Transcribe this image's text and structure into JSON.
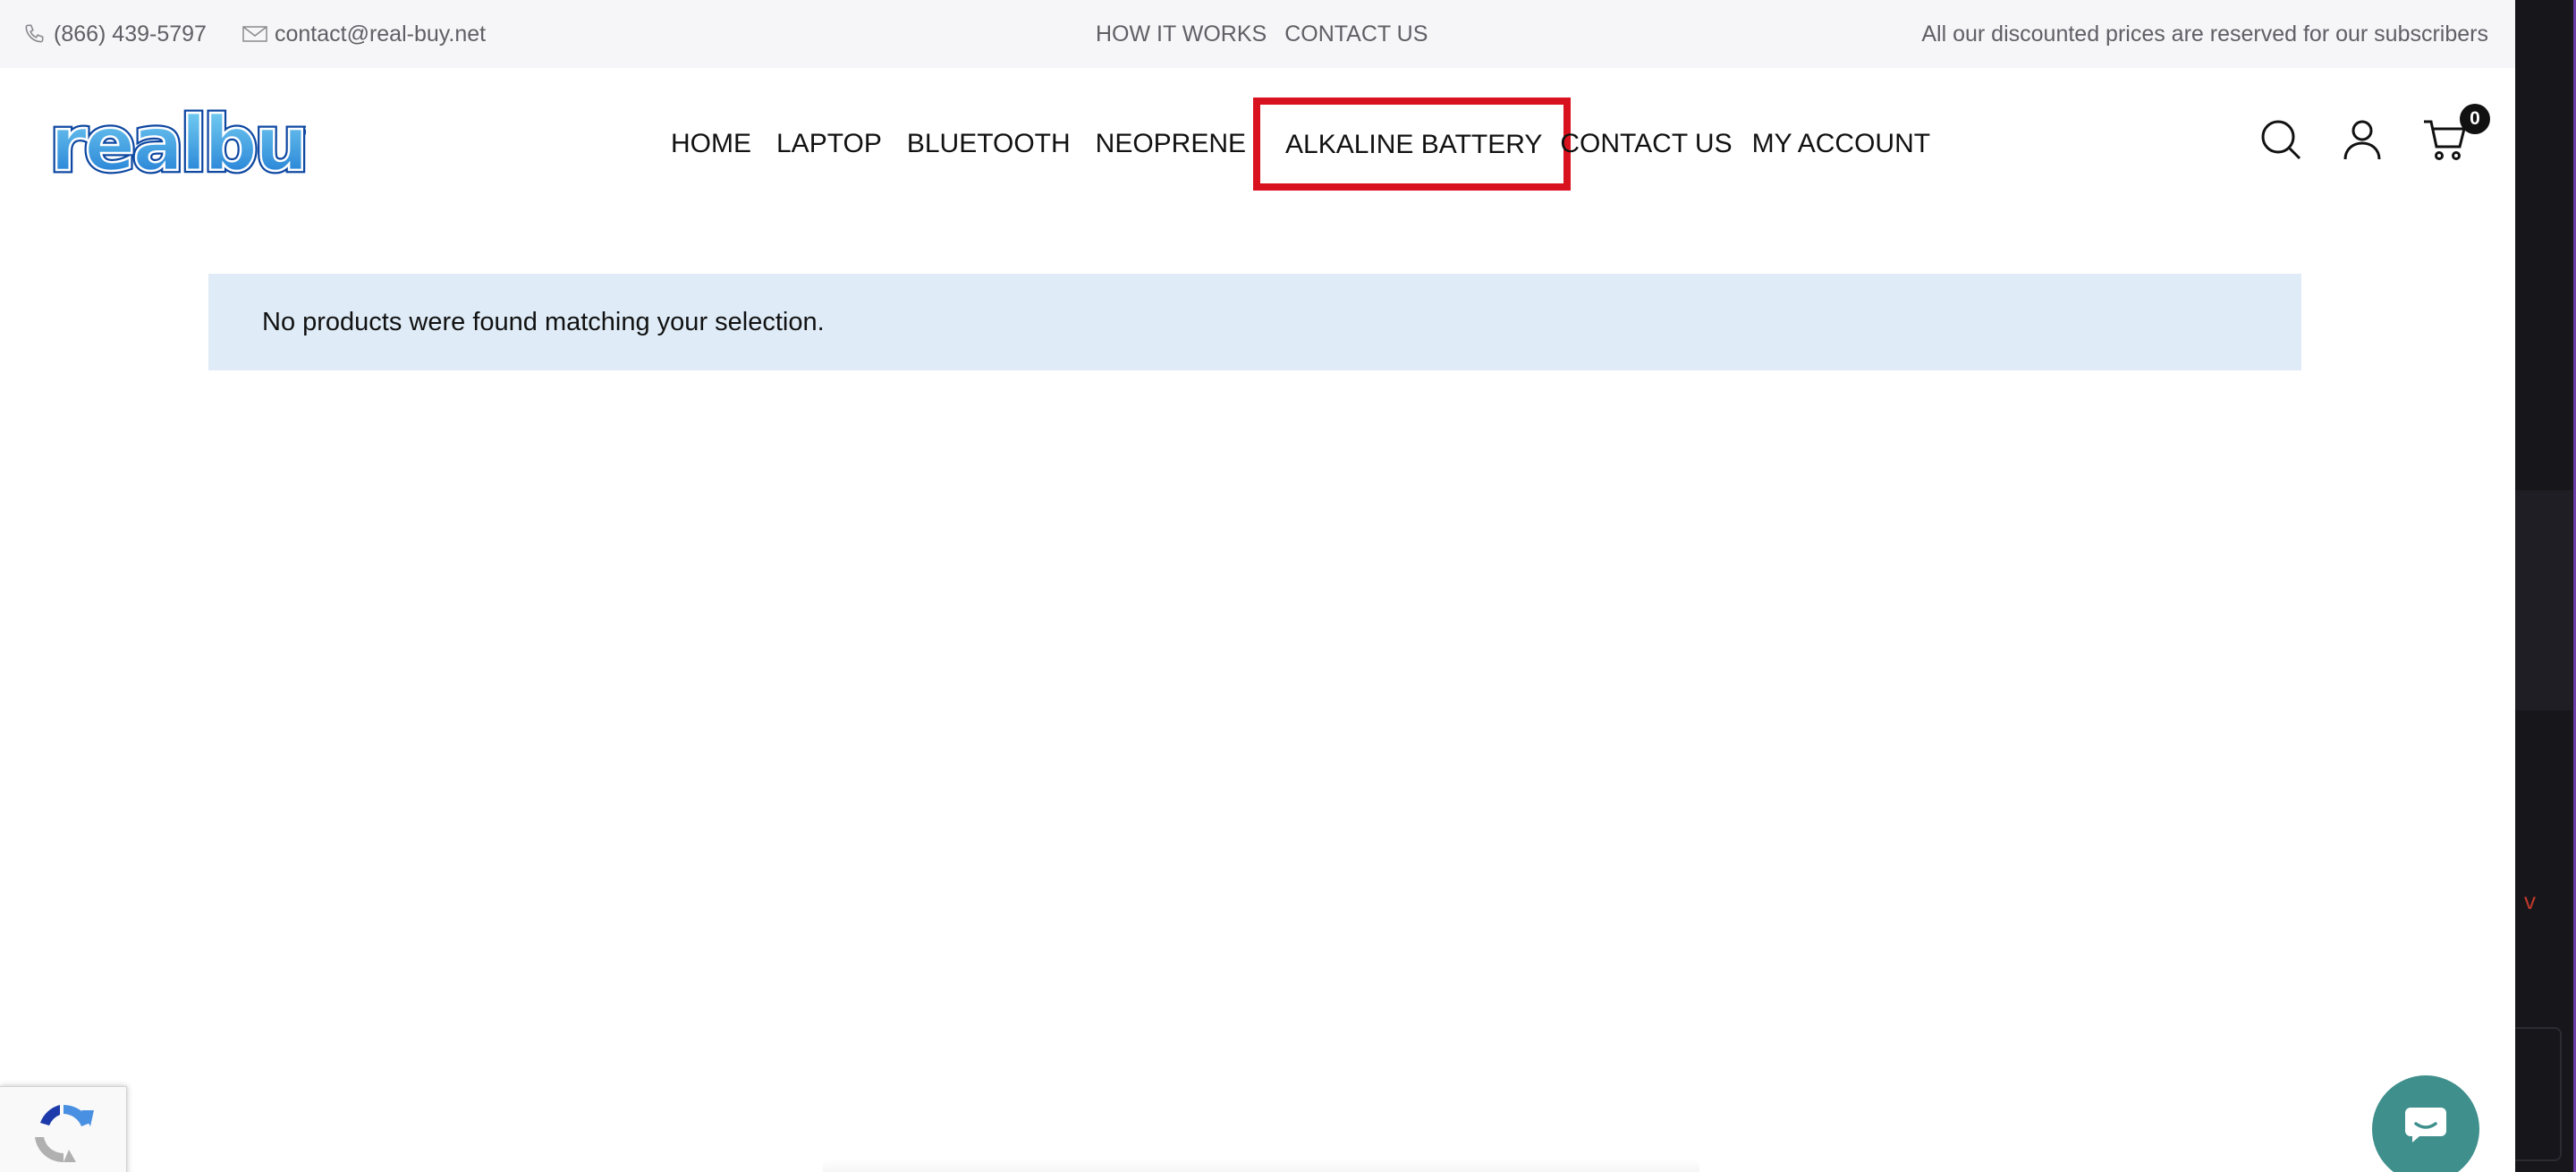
{
  "topbar": {
    "phone": "(866) 439-5797",
    "email": "contact@real-buy.net",
    "links": [
      "HOW IT WORKS",
      "CONTACT US"
    ],
    "promo": "All our discounted prices are reserved for our subscribers"
  },
  "header": {
    "logo_text": "realbuy",
    "nav": [
      "HOME",
      "LAPTOP",
      "BLUETOOTH",
      "NEOPRENE",
      "ALKALINE BATTERY",
      "CONTACT US",
      "MY ACCOUNT"
    ],
    "highlighted_nav": "ALKALINE BATTERY",
    "highlight_color": "#d9121f",
    "icons": [
      "search-icon",
      "account-icon",
      "cart-icon"
    ],
    "cart_count": "0"
  },
  "main": {
    "notice": "No products were found matching your selection."
  },
  "widgets": {
    "recaptcha_icon": "recaptcha-icon",
    "chat_icon": "chat-bubble-icon",
    "chat_color": "#3f8f8c"
  }
}
